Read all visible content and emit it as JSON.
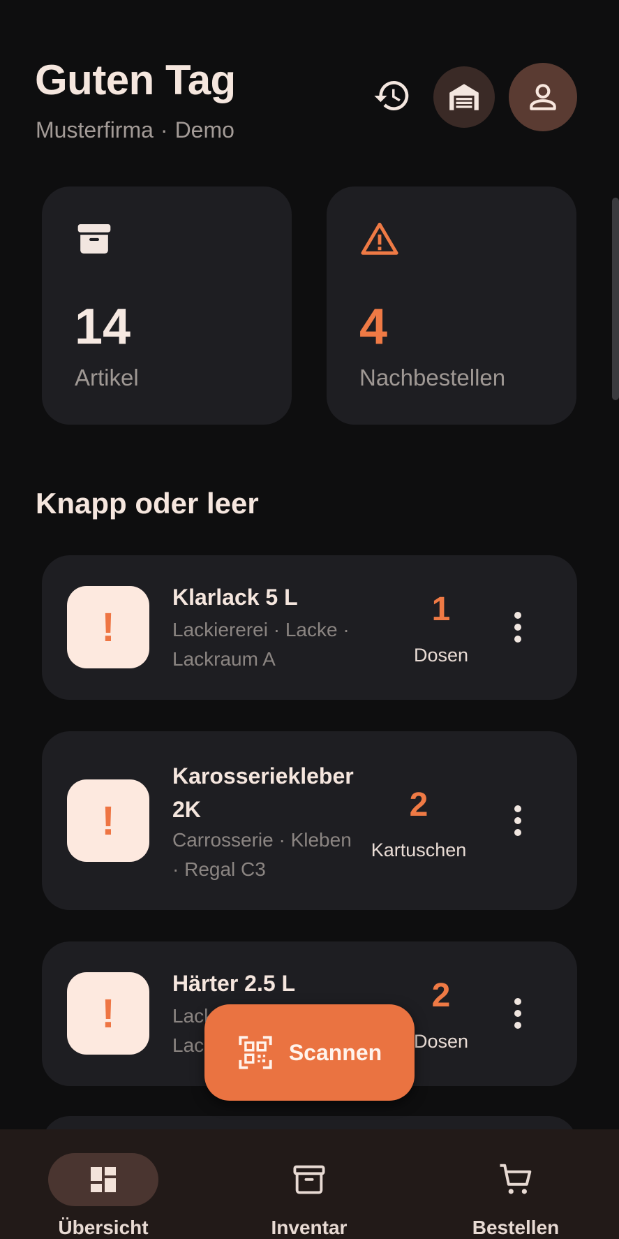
{
  "header": {
    "greeting": "Guten Tag",
    "company": "Musterfirma",
    "separator": "·",
    "mode": "Demo"
  },
  "stats": [
    {
      "value": "14",
      "label": "Artikel",
      "icon": "archive-icon"
    },
    {
      "value": "4",
      "label": "Nachbestellen",
      "icon": "warning-icon"
    }
  ],
  "section": {
    "title": "Knapp oder leer"
  },
  "items": [
    {
      "badge": "!",
      "name_lines": [
        "Klarlack 5 L"
      ],
      "meta_lines": [
        "Lackiererei · Lacke ·",
        "Lackraum A"
      ],
      "qty": "1",
      "unit": "Dosen"
    },
    {
      "badge": "!",
      "name_lines": [
        "Karosseriekleber",
        "2K"
      ],
      "meta_lines": [
        "Carrosserie · Kleben",
        "· Regal C3"
      ],
      "qty": "2",
      "unit": "Kartuschen"
    },
    {
      "badge": "!",
      "name_lines": [
        "Härter 2.5 L"
      ],
      "meta_lines": [
        "Lack",
        "Lac"
      ],
      "qty": "2",
      "unit": "Dosen"
    }
  ],
  "fab": {
    "label": "Scannen",
    "icon": "qr-scan-icon"
  },
  "nav": [
    {
      "label": "Übersicht",
      "icon": "dashboard-icon",
      "active": true
    },
    {
      "label": "Inventar",
      "icon": "archive-icon",
      "active": false
    },
    {
      "label": "Bestellen",
      "icon": "cart-icon",
      "active": false
    }
  ],
  "colors": {
    "background": "#0e0e0f",
    "card": "#1e1e22",
    "accent": "#ef7a45",
    "badge_bg": "#fde9df",
    "nav_bg": "#221a18"
  }
}
